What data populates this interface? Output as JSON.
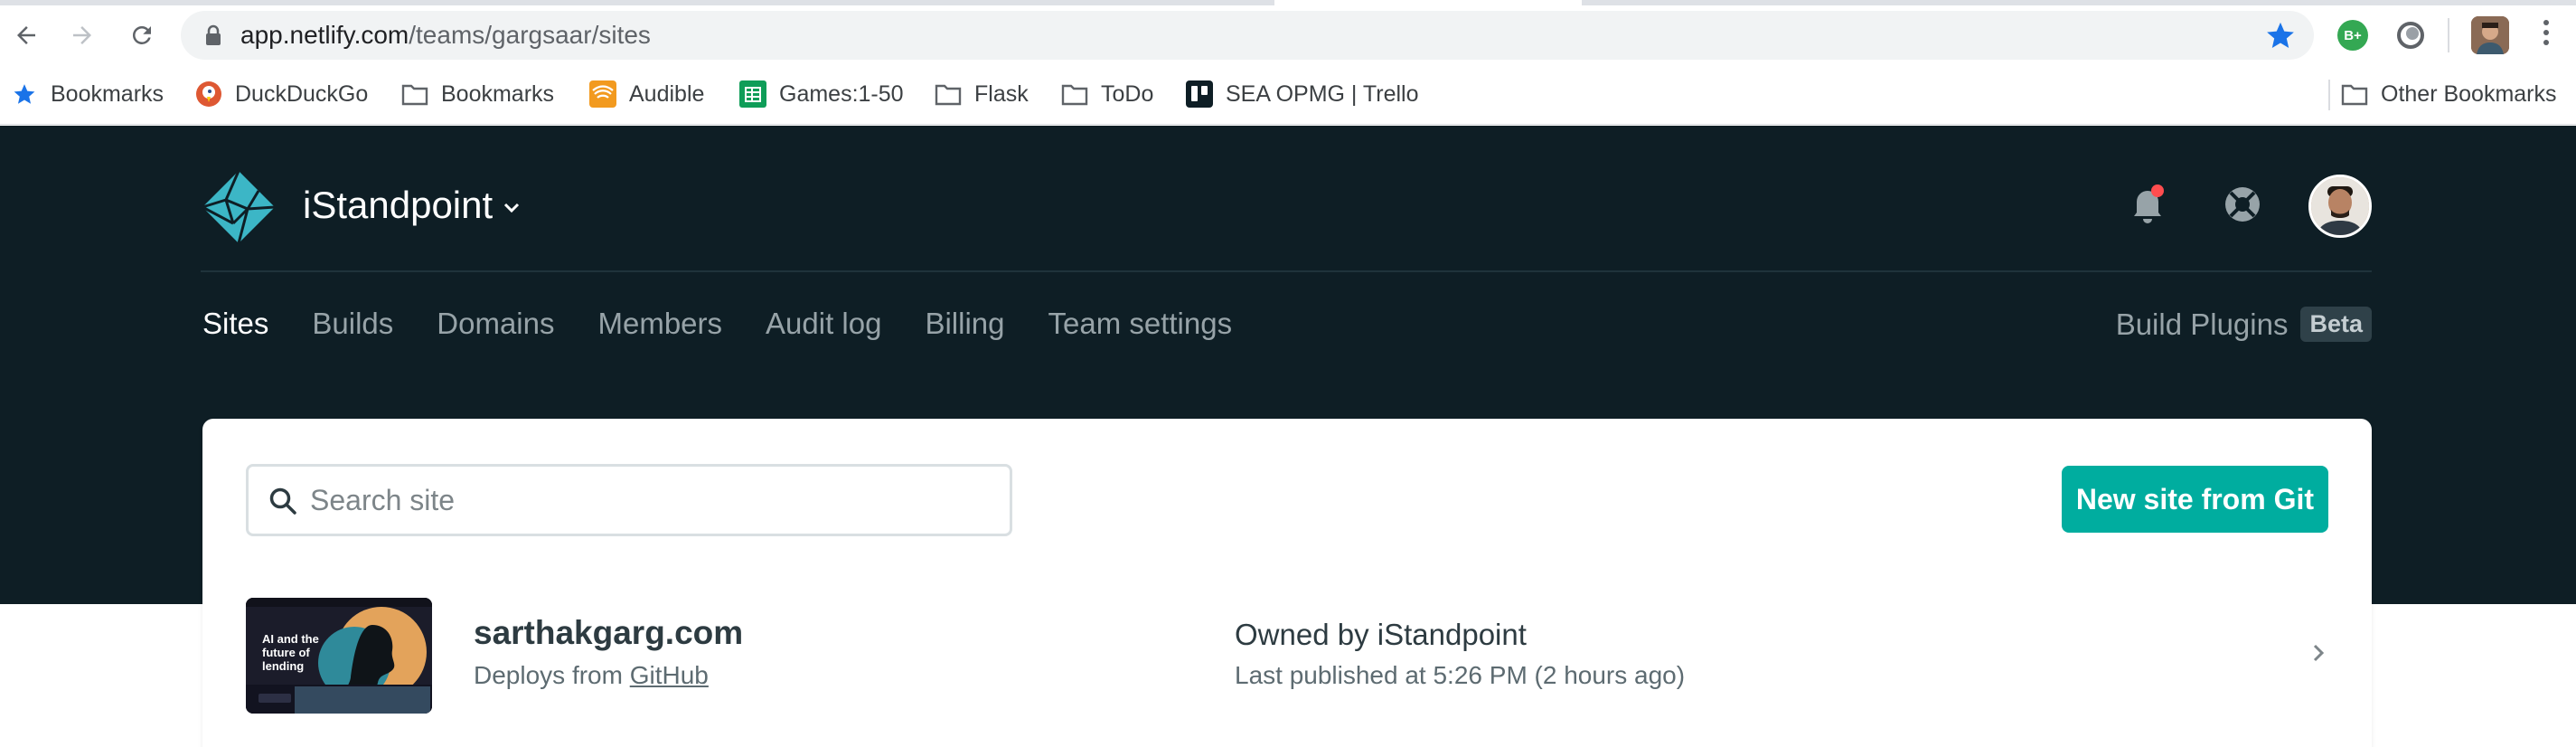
{
  "browser": {
    "url_host": "app.netlify.com",
    "url_path": "/teams/gargsaar/sites",
    "extension_badge": "B+"
  },
  "bookmarks": [
    {
      "label": "Bookmarks",
      "icon": "star-icon"
    },
    {
      "label": "DuckDuckGo",
      "icon": "duckduckgo-icon"
    },
    {
      "label": "Bookmarks",
      "icon": "folder-icon"
    },
    {
      "label": "Audible",
      "icon": "audible-icon"
    },
    {
      "label": "Games:1-50",
      "icon": "sheets-icon"
    },
    {
      "label": "Flask",
      "icon": "folder-icon"
    },
    {
      "label": "ToDo",
      "icon": "folder-icon"
    },
    {
      "label": "SEA OPMG | Trello",
      "icon": "trello-icon"
    }
  ],
  "other_bookmarks": "Other Bookmarks",
  "header": {
    "team_name": "iStandpoint"
  },
  "nav": {
    "tabs": [
      "Sites",
      "Builds",
      "Domains",
      "Members",
      "Audit log",
      "Billing",
      "Team settings"
    ],
    "active_tab": "Sites",
    "plugins_label": "Build Plugins",
    "beta_label": "Beta"
  },
  "sites_panel": {
    "search_placeholder": "Search site",
    "new_site_label": "New site from Git"
  },
  "sites": [
    {
      "name": "sarthakgarg.com",
      "deploys_prefix": "Deploys from",
      "deploys_source": "GitHub",
      "owner_prefix": "Owned by",
      "owner": "iStandpoint",
      "published": "Last published at 5:26 PM (2 hours ago)",
      "thumbnail_text": "AI and the future of lending"
    }
  ],
  "colors": {
    "header_bg": "#0e1e25",
    "accent": "#00ad9f",
    "logo": "#3cb6c6",
    "notification_dot": "#ff4d4f"
  }
}
